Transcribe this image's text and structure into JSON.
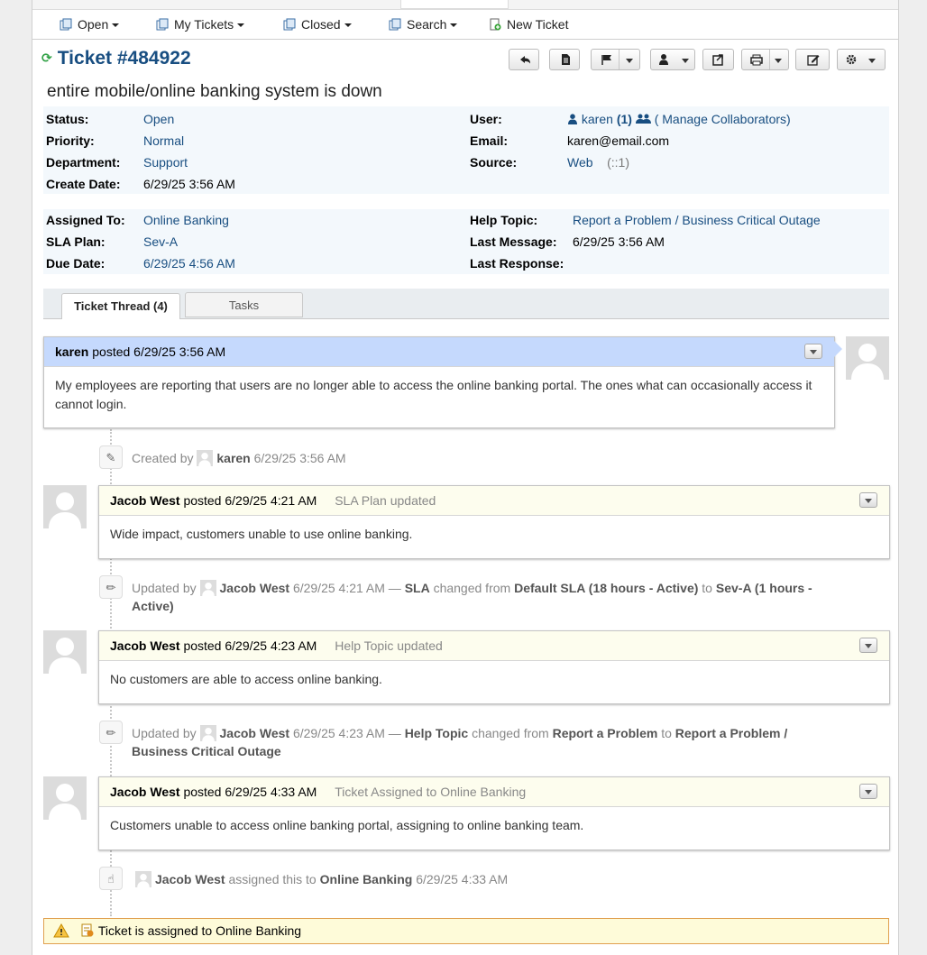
{
  "nav": {
    "items": [
      {
        "label": "Open",
        "caret": true
      },
      {
        "label": "My Tickets",
        "caret": true
      },
      {
        "label": "Closed",
        "caret": true
      },
      {
        "label": "Search",
        "caret": true
      },
      {
        "label": "New Ticket",
        "caret": false
      }
    ]
  },
  "ticket": {
    "title": "Ticket #484922",
    "subject": "entire mobile/online banking system is down"
  },
  "info1": {
    "status_label": "Status:",
    "status": "Open",
    "priority_label": "Priority:",
    "priority": "Normal",
    "department_label": "Department:",
    "department": "Support",
    "create_label": "Create Date:",
    "create": "6/29/25 3:56 AM",
    "user_label": "User:",
    "user": "karen",
    "user_count": "(1)",
    "manage": "( Manage Collaborators)",
    "email_label": "Email:",
    "email": "karen@email.com",
    "source_label": "Source:",
    "source": "Web",
    "source_ip": "(::1)"
  },
  "info2": {
    "assigned_label": "Assigned To:",
    "assigned": "Online Banking",
    "sla_label": "SLA Plan:",
    "sla": "Sev-A",
    "due_label": "Due Date:",
    "due": "6/29/25 4:56 AM",
    "topic_label": "Help Topic:",
    "topic": "Report a Problem / Business Critical Outage",
    "last_msg_label": "Last Message:",
    "last_msg": "6/29/25 3:56 AM",
    "last_resp_label": "Last Response:"
  },
  "tabs": {
    "thread": "Ticket Thread (4)",
    "tasks": "Tasks"
  },
  "thread": {
    "m1": {
      "name": "karen",
      "posted": "posted 6/29/25 3:56 AM",
      "body": "My employees are reporting that users are no longer able to access the online banking portal. The ones what can occasionally access it cannot login."
    },
    "e1": {
      "prefix": "Created by",
      "name": "karen",
      "time": "6/29/25 3:56 AM"
    },
    "m2": {
      "name": "Jacob West",
      "posted": "posted 6/29/25 4:21 AM",
      "title": "SLA Plan updated",
      "body": "Wide impact, customers unable to use online banking."
    },
    "e2": {
      "prefix": "Updated by",
      "name": "Jacob West",
      "time": "6/29/25 4:21 AM —",
      "field": "SLA",
      "changed": "changed from",
      "from": "Default SLA (18 hours - Active)",
      "to_word": "to",
      "to1": "Sev-A (1 hours -",
      "to2": "Active)"
    },
    "m3": {
      "name": "Jacob West",
      "posted": "posted 6/29/25 4:23 AM",
      "title": "Help Topic updated",
      "body": "No customers are able to access online banking."
    },
    "e3": {
      "prefix": "Updated by",
      "name": "Jacob West",
      "time": "6/29/25 4:23 AM —",
      "field": "Help Topic",
      "changed": "changed from",
      "from": "Report a Problem",
      "to_word": "to",
      "to1": "Report a Problem /",
      "to2": "Business Critical Outage"
    },
    "m4": {
      "name": "Jacob West",
      "posted": "posted 6/29/25 4:33 AM",
      "title": "Ticket Assigned to Online Banking",
      "body": "Customers unable to access online banking portal, assigning to online banking team."
    },
    "e4": {
      "name": "Jacob West",
      "action": "assigned this to",
      "target": "Online Banking",
      "time": "6/29/25 4:33 AM"
    }
  },
  "notice": {
    "text": "Ticket is assigned to Online Banking"
  },
  "colors": {
    "link": "#184e81",
    "user_header": "#c5d9fd",
    "staff_header": "#fdfdee",
    "notice_bg": "#fefbd9"
  }
}
